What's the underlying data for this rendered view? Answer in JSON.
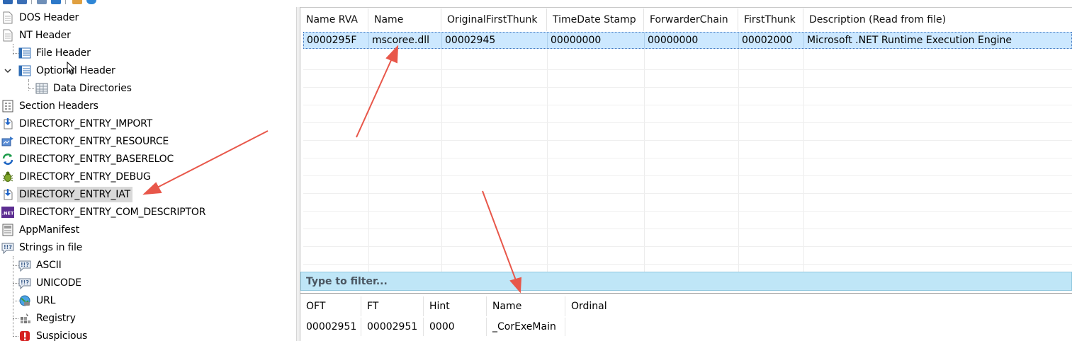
{
  "tree": {
    "items": [
      {
        "label": "DOS Header",
        "icon": "document-icon"
      },
      {
        "label": "NT Header",
        "icon": "document-icon"
      },
      {
        "label": "File Header",
        "icon": "table-icon"
      },
      {
        "label": "Optional Header",
        "icon": "table-icon"
      },
      {
        "label": "Data Directories",
        "icon": "grid-table-icon"
      },
      {
        "label": "Section Headers",
        "icon": "sections-icon"
      },
      {
        "label": "DIRECTORY_ENTRY_IMPORT",
        "icon": "import-icon"
      },
      {
        "label": "DIRECTORY_ENTRY_RESOURCE",
        "icon": "resource-icon"
      },
      {
        "label": "DIRECTORY_ENTRY_BASERELOC",
        "icon": "reloc-icon"
      },
      {
        "label": "DIRECTORY_ENTRY_DEBUG",
        "icon": "bug-icon"
      },
      {
        "label": "DIRECTORY_ENTRY_IAT",
        "icon": "import-icon"
      },
      {
        "label": "DIRECTORY_ENTRY_COM_DESCRIPTOR",
        "icon": "dotnet-icon"
      },
      {
        "label": "AppManifest",
        "icon": "manifest-icon"
      },
      {
        "label": "Strings in file",
        "icon": "strings-icon"
      },
      {
        "label": "ASCII",
        "icon": "strings-icon"
      },
      {
        "label": "UNICODE",
        "icon": "strings-icon"
      },
      {
        "label": "URL",
        "icon": "globe-icon"
      },
      {
        "label": "Registry",
        "icon": "registry-icon"
      },
      {
        "label": "Suspicious",
        "icon": "warning-icon"
      }
    ],
    "selected": "DIRECTORY_ENTRY_IAT",
    "dotnet_badge": ".NET"
  },
  "upper_table": {
    "columns": [
      "Name RVA",
      "Name",
      "OriginalFirstThunk",
      "TimeDate Stamp",
      "ForwarderChain",
      "FirstThunk",
      "Description (Read from file)"
    ],
    "rows": [
      [
        "0000295F",
        "mscoree.dll",
        "00002945",
        "00000000",
        "00000000",
        "00002000",
        "Microsoft .NET Runtime Execution Engine"
      ]
    ]
  },
  "filter": {
    "placeholder": "Type to filter..."
  },
  "lower_table": {
    "columns": [
      "OFT",
      "FT",
      "Hint",
      "Name",
      "Ordinal"
    ],
    "rows": [
      [
        "00002951",
        "00002951",
        "0000",
        "_CorExeMain",
        ""
      ]
    ]
  },
  "colors": {
    "selection_row": "#cce8ff",
    "filter_bar": "#bfe6f7",
    "annotation_arrow": "#e8574a",
    "tree_selected": "#d9d9d9"
  }
}
